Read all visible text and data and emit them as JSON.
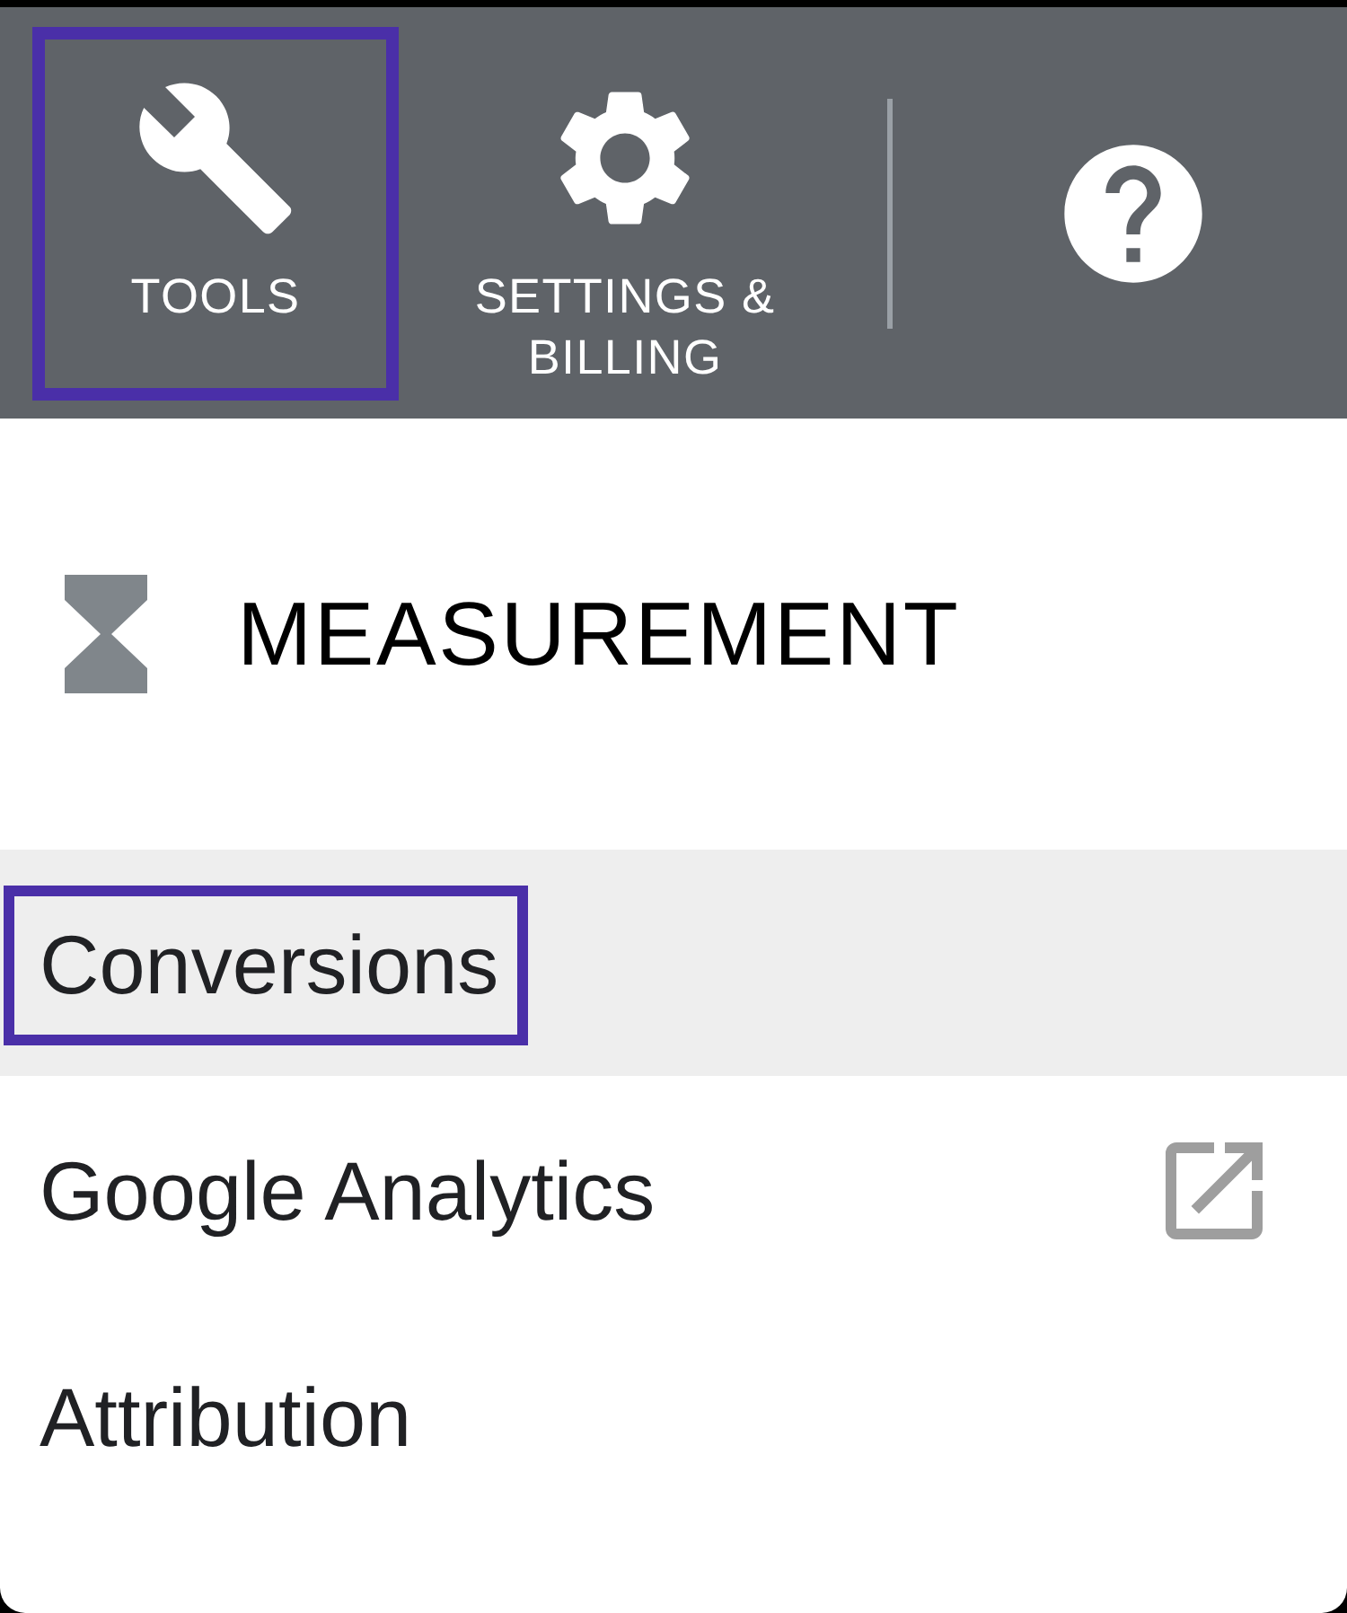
{
  "toolbar": {
    "buttons": [
      {
        "kind": "wrench",
        "label": "TOOLS",
        "highlighted": true
      },
      {
        "kind": "gear",
        "label": "SETTINGS & BILLING",
        "highlighted": false
      }
    ],
    "help": {
      "kind": "help"
    }
  },
  "section": {
    "title": "MEASUREMENT"
  },
  "menu": [
    {
      "label": "Conversions",
      "selected": true,
      "highlighted": true,
      "external": false
    },
    {
      "label": "Google Analytics",
      "selected": false,
      "highlighted": false,
      "external": true
    },
    {
      "label": "Attribution",
      "selected": false,
      "highlighted": false,
      "external": false
    }
  ]
}
